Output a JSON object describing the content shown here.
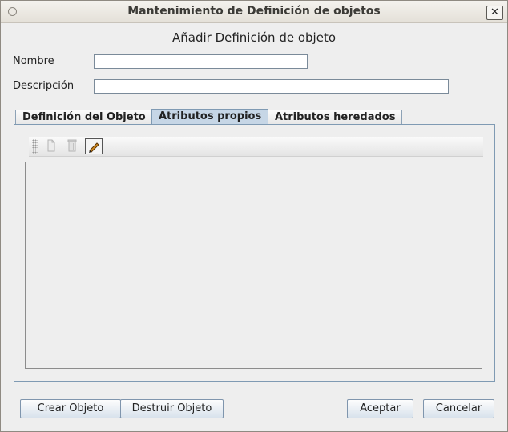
{
  "window": {
    "title": "Mantenimiento de Definición de objetos",
    "close_glyph": "✕"
  },
  "dialog": {
    "heading": "Añadir Definición de objeto"
  },
  "form": {
    "nombre_label": "Nombre",
    "nombre_value": "",
    "descripcion_label": "Descripción",
    "descripcion_value": ""
  },
  "tabs": [
    {
      "label": "Definición del Objeto",
      "active": false
    },
    {
      "label": "Atributos propios",
      "active": true
    },
    {
      "label": "Atributos heredados",
      "active": false
    }
  ],
  "toolbar": {
    "icons": [
      "grip-icon",
      "new-document-icon",
      "delete-icon",
      "edit-pencil-icon"
    ]
  },
  "buttons": {
    "crear": "Crear Objeto",
    "destruir": "Destruir Objeto",
    "aceptar": "Aceptar",
    "cancelar": "Cancelar"
  },
  "colors": {
    "active_tab": "#c6d6e6",
    "tab_border": "#7f9ab3",
    "window_bg": "#eeeeee"
  }
}
